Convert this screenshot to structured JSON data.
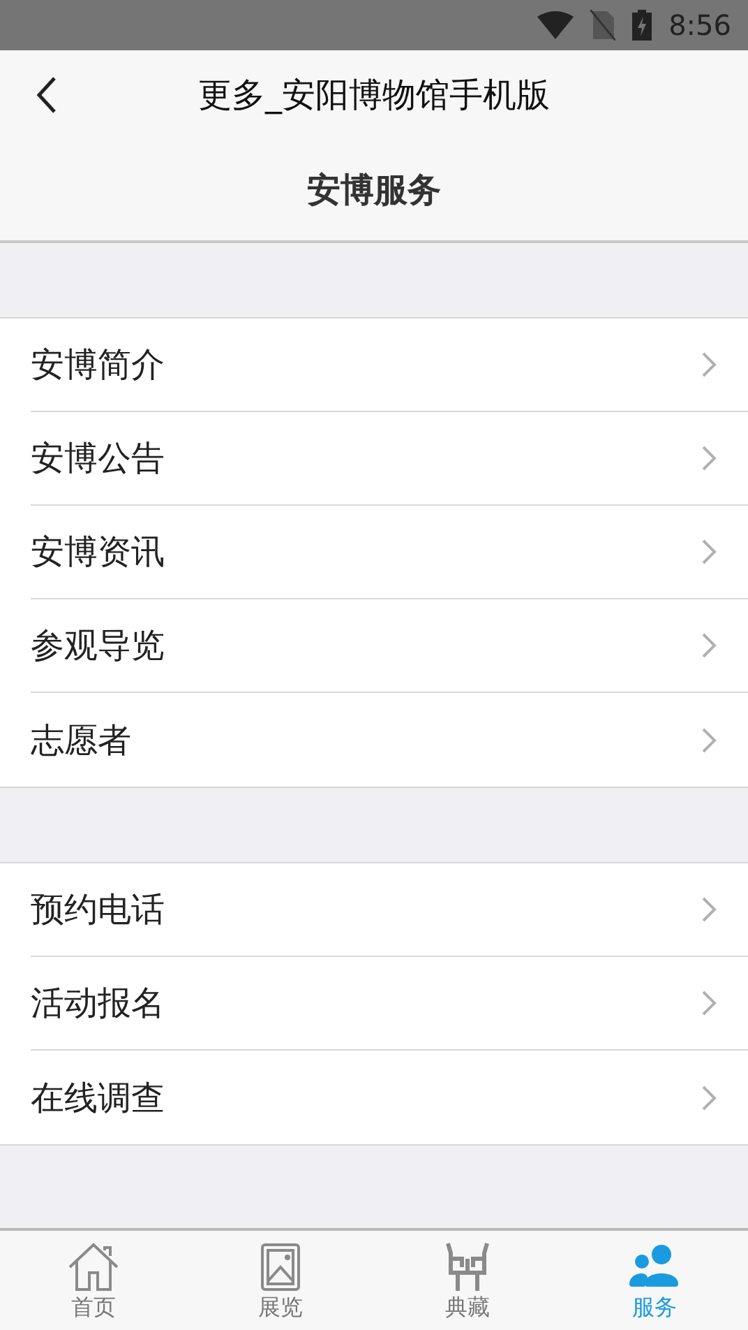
{
  "status_bar": {
    "time": "8:56"
  },
  "header": {
    "title": "更多_安阳博物馆手机版"
  },
  "section_title": "安博服务",
  "groups": [
    {
      "items": [
        {
          "label": "安博简介"
        },
        {
          "label": "安博公告"
        },
        {
          "label": "安博资讯"
        },
        {
          "label": "参观导览"
        },
        {
          "label": "志愿者"
        }
      ]
    },
    {
      "items": [
        {
          "label": "预约电话"
        },
        {
          "label": "活动报名"
        },
        {
          "label": "在线调查"
        }
      ]
    }
  ],
  "tab_bar": [
    {
      "kind": "home",
      "label": "首页",
      "selected": false
    },
    {
      "kind": "exhibition",
      "label": "展览",
      "selected": false
    },
    {
      "kind": "collection",
      "label": "典藏",
      "selected": false
    },
    {
      "kind": "service",
      "label": "服务",
      "selected": true
    }
  ]
}
